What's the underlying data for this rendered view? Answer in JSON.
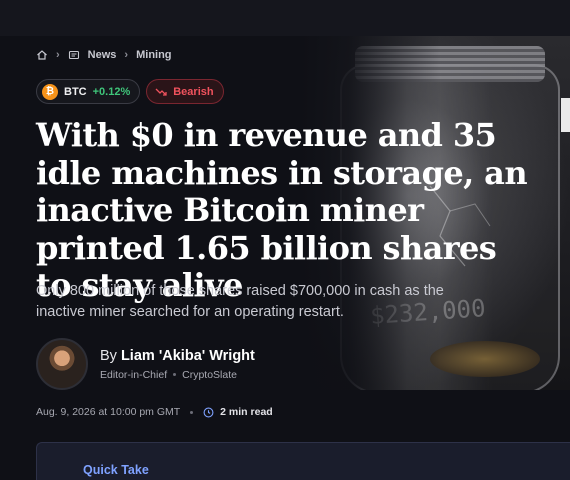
{
  "breadcrumb": {
    "items": [
      "News",
      "Mining"
    ]
  },
  "chips": {
    "ticker": "BTC",
    "ticker_symbol": "₿",
    "change": "+0.12%",
    "sentiment": "Bearish"
  },
  "article": {
    "headline": "With $0 in revenue and 35 idle machines in storage, an inactive Bitcoin miner printed 1.65 billion shares to stay alive",
    "subhead": "Only 800 million of those shares raised $700,000 in cash as the inactive miner searched for an operating restart.",
    "hero_jar_label": "$232,000"
  },
  "author": {
    "by": "By",
    "name": "Liam 'Akiba' Wright",
    "role": "Editor-in-Chief",
    "outlet": "CryptoSlate"
  },
  "meta": {
    "date": "Aug. 9, 2026 at 10:00 pm GMT",
    "read_time": "2 min read"
  },
  "quick_take": {
    "title": "Quick Take"
  },
  "colors": {
    "background": "#0f1016",
    "btc_orange": "#f7931a",
    "positive": "#3fc57a",
    "bearish": "#f0525d",
    "accent": "#7fa2ff"
  }
}
